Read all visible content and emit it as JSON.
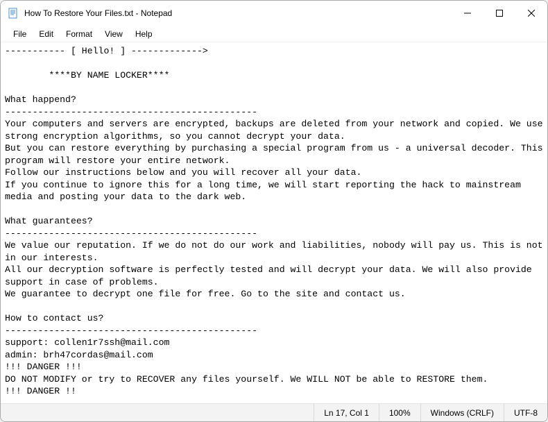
{
  "titlebar": {
    "title": "How To Restore Your Files.txt - Notepad"
  },
  "menu": {
    "file": "File",
    "edit": "Edit",
    "format": "Format",
    "view": "View",
    "help": "Help"
  },
  "editor": {
    "content": "----------- [ Hello! ] ------------->\n\n        ****BY NAME LOCKER****\n\nWhat happend?\n----------------------------------------------\nYour computers and servers are encrypted, backups are deleted from your network and copied. We use strong encryption algorithms, so you cannot decrypt your data.\nBut you can restore everything by purchasing a special program from us - a universal decoder. This program will restore your entire network.\nFollow our instructions below and you will recover all your data.\nIf you continue to ignore this for a long time, we will start reporting the hack to mainstream media and posting your data to the dark web.\n\nWhat guarantees?\n----------------------------------------------\nWe value our reputation. If we do not do our work and liabilities, nobody will pay us. This is not in our interests.\nAll our decryption software is perfectly tested and will decrypt your data. We will also provide support in case of problems.\nWe guarantee to decrypt one file for free. Go to the site and contact us.\n\nHow to contact us?\n----------------------------------------------\nsupport: collen1r7ssh@mail.com\nadmin: brh47cordas@mail.com\n!!! DANGER !!!\nDO NOT MODIFY or try to RECOVER any files yourself. We WILL NOT be able to RESTORE them.\n!!! DANGER !!"
  },
  "statusbar": {
    "position": "Ln 17, Col 1",
    "zoom": "100%",
    "lineending": "Windows (CRLF)",
    "encoding": "UTF-8"
  }
}
